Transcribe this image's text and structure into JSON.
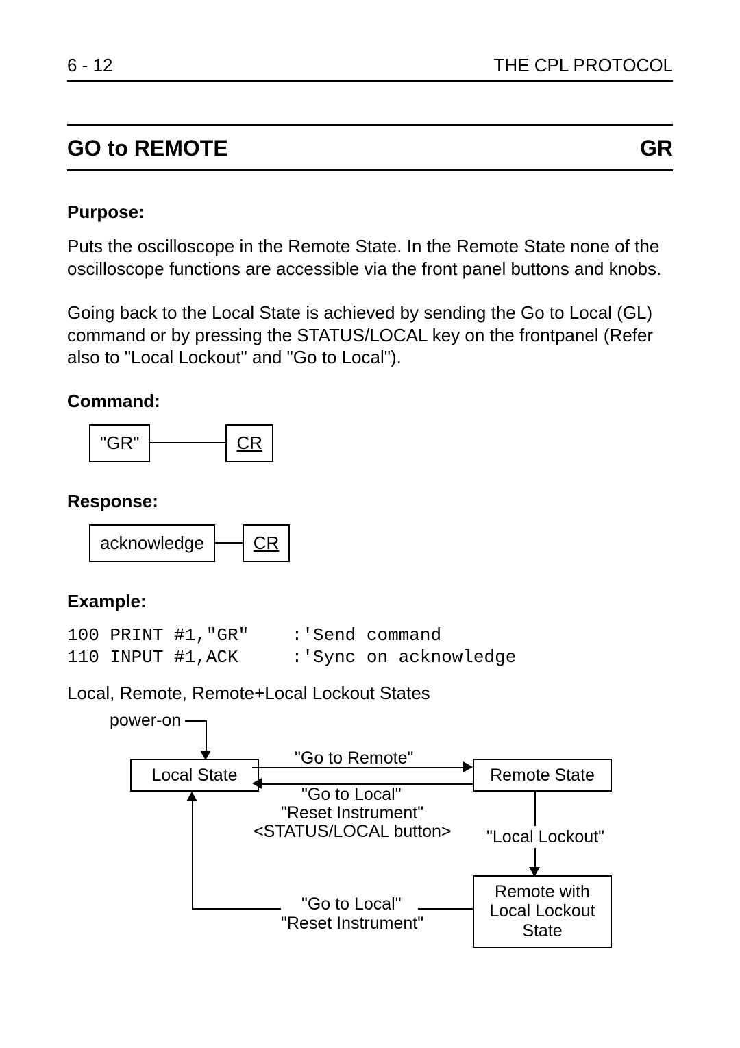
{
  "header": {
    "left": "6 - 12",
    "right": "THE CPL PROTOCOL"
  },
  "title": {
    "left": "GO to REMOTE",
    "right": "GR"
  },
  "purpose_label": "Purpose:",
  "purpose_p1": "Puts the oscilloscope in the Remote State. In the Remote State none of the oscilloscope functions are accessible via the front panel buttons and knobs.",
  "purpose_p2": "Going back to the Local State is achieved by sending the Go to Local (GL) command or by pressing the STATUS/LOCAL key on the frontpanel (Refer also to \"Local Lockout\" and \"Go to Local\").",
  "command_label": "Command:",
  "command_box1": "\"GR\"",
  "command_box2": "CR",
  "response_label": "Response:",
  "response_box1": "acknowledge",
  "response_box2": "CR",
  "example_label": "Example:",
  "example_code": "100 PRINT #1,\"GR\"    :'Send command\n110 INPUT #1,ACK     :'Sync on acknowledge",
  "states_caption": "Local, Remote, Remote+Local Lockout States",
  "sd": {
    "power_on": "power-on",
    "local_state": "Local State",
    "remote_state": "Remote State",
    "go_to_remote": "\"Go to Remote\"",
    "go_to_local": "\"Go to Local\"",
    "reset_instr": "\"Reset Instrument\"",
    "status_btn": "<STATUS/LOCAL button>",
    "local_lockout": "\"Local Lockout\"",
    "remote_with_ll": "Remote with\nLocal Lockout\nState"
  }
}
